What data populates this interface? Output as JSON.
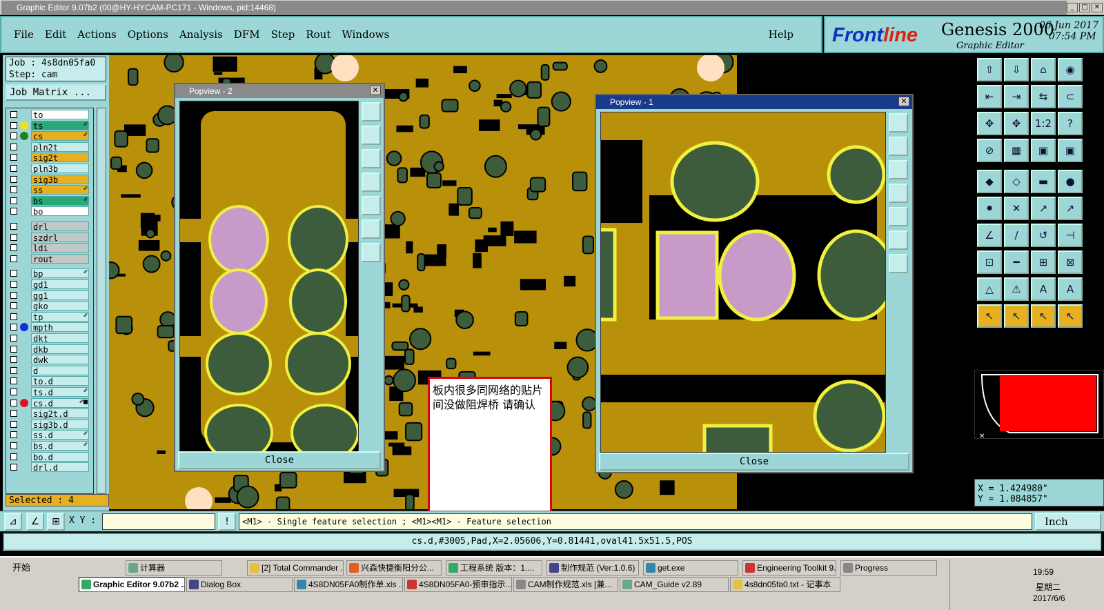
{
  "window": {
    "title": "Graphic Editor 9.07b2 (00@HY-HYCAM-PC171 - Windows, pid:14468)",
    "controls": [
      "_",
      "□",
      "✕"
    ]
  },
  "menu": {
    "items": [
      "File",
      "Edit",
      "Actions",
      "Options",
      "Analysis",
      "DFM",
      "Step",
      "Rout",
      "Windows"
    ],
    "help": "Help"
  },
  "brand": {
    "logo_prefix": "Front",
    "logo_suffix": "line",
    "product": "Genesis 2000",
    "subtitle": "Graphic Editor",
    "date": "06 Jun 2017",
    "time": "07:54 PM"
  },
  "job": {
    "job_line": "Job : 4s8dn05fa0",
    "step_line": "Step: cam",
    "matrix_button": "Job Matrix ..."
  },
  "layers": [
    {
      "name": "to",
      "color": "#ffffff",
      "dot": "",
      "flag": ""
    },
    {
      "name": "ts",
      "color": "#2aa878",
      "dot": "#f0e020",
      "flag": "✐"
    },
    {
      "name": "cs",
      "color": "#e6b020",
      "dot": "#208020",
      "flag": "✐"
    },
    {
      "name": "pln2t",
      "color": "#c6ecec",
      "dot": "",
      "flag": ""
    },
    {
      "name": "sig2t",
      "color": "#e6b020",
      "dot": "",
      "flag": ""
    },
    {
      "name": "pln3b",
      "color": "#c6ecec",
      "dot": "",
      "flag": ""
    },
    {
      "name": "sig3b",
      "color": "#e6b020",
      "dot": "",
      "flag": ""
    },
    {
      "name": "ss",
      "color": "#e6b020",
      "dot": "",
      "flag": "✐"
    },
    {
      "name": "bs",
      "color": "#2aa878",
      "dot": "",
      "flag": "✐"
    },
    {
      "name": "bo",
      "color": "#ffffff",
      "dot": "",
      "flag": ""
    },
    {
      "name": "drl",
      "color": "#c0c8c8",
      "dot": "",
      "flag": ""
    },
    {
      "name": "szdrl",
      "color": "#c0c8c8",
      "dot": "",
      "flag": ""
    },
    {
      "name": "ldi",
      "color": "#c0c8c8",
      "dot": "",
      "flag": ""
    },
    {
      "name": "rout",
      "color": "#c0c8c8",
      "dot": "",
      "flag": ""
    },
    {
      "name": "bp",
      "color": "#c6ecec",
      "dot": "",
      "flag": "✐"
    },
    {
      "name": "gd1",
      "color": "#c6ecec",
      "dot": "",
      "flag": ""
    },
    {
      "name": "gg1",
      "color": "#c6ecec",
      "dot": "",
      "flag": ""
    },
    {
      "name": "gko",
      "color": "#c6ecec",
      "dot": "",
      "flag": ""
    },
    {
      "name": "tp",
      "color": "#c6ecec",
      "dot": "",
      "flag": "✐"
    },
    {
      "name": "mpth",
      "color": "#c6ecec",
      "dot": "#1030e0",
      "flag": ""
    },
    {
      "name": "dkt",
      "color": "#c6ecec",
      "dot": "",
      "flag": ""
    },
    {
      "name": "dkb",
      "color": "#c6ecec",
      "dot": "",
      "flag": ""
    },
    {
      "name": "dwk",
      "color": "#c6ecec",
      "dot": "",
      "flag": ""
    },
    {
      "name": "d",
      "color": "#c6ecec",
      "dot": "",
      "flag": ""
    },
    {
      "name": "to.d",
      "color": "#c6ecec",
      "dot": "",
      "flag": ""
    },
    {
      "name": "ts.d",
      "color": "#c6ecec",
      "dot": "",
      "flag": "✐"
    },
    {
      "name": "cs.d",
      "color": "#c6ecec",
      "dot": "#e01020",
      "flag": "✐■"
    },
    {
      "name": "sig2t.d",
      "color": "#c6ecec",
      "dot": "",
      "flag": ""
    },
    {
      "name": "sig3b.d",
      "color": "#c6ecec",
      "dot": "",
      "flag": ""
    },
    {
      "name": "ss.d",
      "color": "#c6ecec",
      "dot": "",
      "flag": "✐"
    },
    {
      "name": "bs.d",
      "color": "#c6ecec",
      "dot": "",
      "flag": "✐"
    },
    {
      "name": "bo.d",
      "color": "#c6ecec",
      "dot": "",
      "flag": ""
    },
    {
      "name": "drl.d",
      "color": "#c6ecec",
      "dot": "",
      "flag": ""
    }
  ],
  "selected": "Selected : 4",
  "popview2": {
    "title": "Popview - 2",
    "close": "Close"
  },
  "popview1": {
    "title": "Popview - 1",
    "close": "Close"
  },
  "note": {
    "text": "板内很多同网络的贴片间没做阻焊桥 请确认"
  },
  "right_tools": [
    "⇧",
    "⇩",
    "⌂",
    "◉",
    "⇤",
    "⇥",
    "⇆",
    "⊂",
    "✥",
    "✥",
    "1:2",
    "?",
    "⊘",
    "▦",
    "▣",
    "▣",
    "◆",
    "◇",
    "▬",
    "●",
    "⚫",
    "✕",
    "↗",
    "↗",
    "∠",
    "∕",
    "↺",
    "⊣",
    "⊡",
    "━",
    "⊞",
    "⊠",
    "△",
    "⚠",
    "A",
    "A",
    "↖",
    "↖",
    "↖",
    "↖"
  ],
  "coords": {
    "x": "X = 1.424980\"",
    "y": "Y = 1.084857\""
  },
  "bottom": {
    "xy_label": "X Y :",
    "xy_value": "",
    "message": "<M1> - Single feature selection ; <M1><M1> - Feature selection",
    "unit": "Inch"
  },
  "status": "cs.d,#3005,Pad,X=2.05606,Y=0.81441,oval41.5x51.5,POS",
  "taskbar": {
    "start": "开始",
    "row1": [
      "计算器",
      "[2] Total Commander ...",
      "兴森快捷衡阳分公...",
      "工程系统  版本：1....",
      "制作规范 (Ver:1.0.6)",
      "get.exe",
      "Engineering Toolkit 9....",
      "Progress"
    ],
    "row2": [
      "Graphic Editor 9.07b2 ...",
      "Dialog Box",
      "4S8DN05FA0制作单.xls ...",
      "4S8DN05FA0-预审指示....",
      "CAM制作规范.xls [兼...",
      "CAM_Guide v2.89",
      "4s8dn05fa0.txt - 记事本"
    ],
    "clock": "19:59",
    "weekday": "星期二",
    "date": "2017/6/6"
  },
  "colors": {
    "copper": "#b8900a",
    "mask": "#3c5c3c",
    "paste": "#c89ac8",
    "outline": "#f0f040",
    "panel": "#9cd6d6"
  }
}
